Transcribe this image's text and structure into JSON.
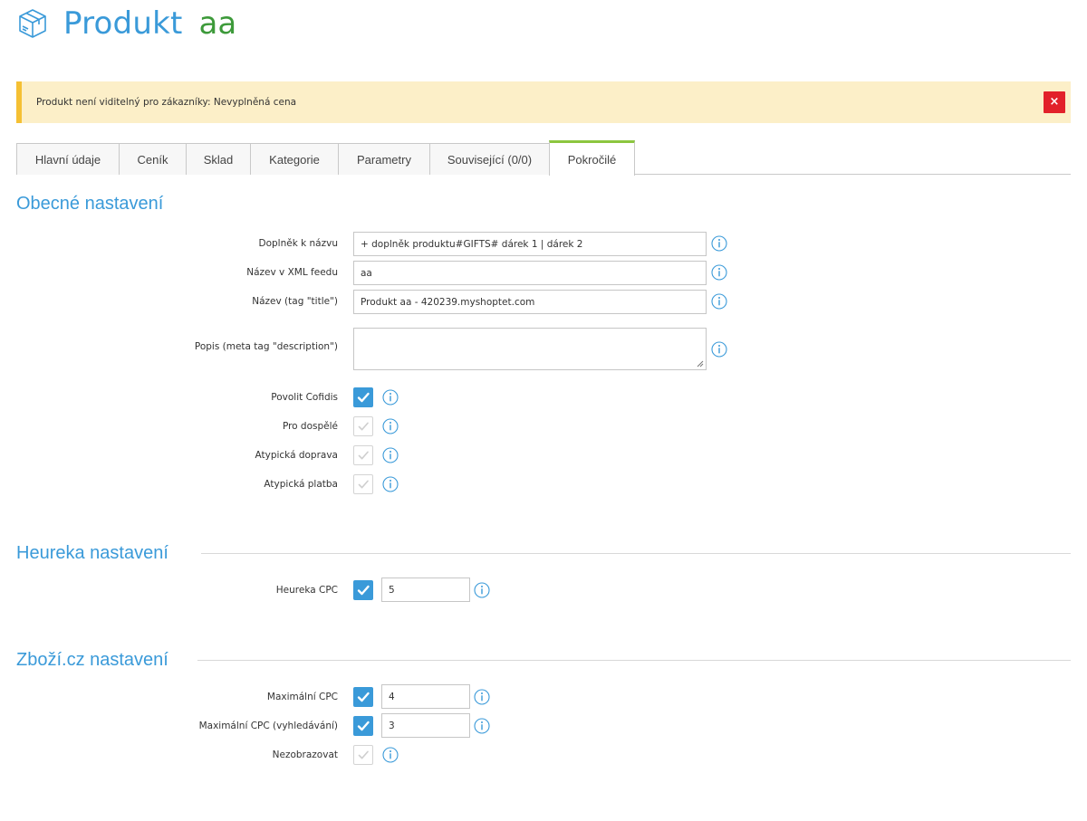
{
  "header": {
    "title": "Produkt",
    "product_name": "aa",
    "icon": "box-icon"
  },
  "alert": {
    "text": "Produkt není viditelný pro zákazníky: Nevyplněná cena",
    "close_label": "×"
  },
  "tabs": [
    {
      "label": "Hlavní údaje",
      "active": false
    },
    {
      "label": "Ceník",
      "active": false
    },
    {
      "label": "Sklad",
      "active": false
    },
    {
      "label": "Kategorie",
      "active": false
    },
    {
      "label": "Parametry",
      "active": false
    },
    {
      "label": "Související (0/0)",
      "active": false
    },
    {
      "label": "Pokročilé",
      "active": true
    }
  ],
  "general": {
    "title": "Obecné nastavení",
    "name_addon": {
      "label": "Doplněk k názvu",
      "value": "+ doplněk produktu#GIFTS# dárek 1 | dárek 2"
    },
    "xml_name": {
      "label": "Název v XML feedu",
      "value": "aa"
    },
    "title_tag": {
      "label": "Název (tag \"title\")",
      "value": "Produkt  aa  - 420239.myshoptet.com"
    },
    "description": {
      "label": "Popis (meta tag \"description\")",
      "value": ""
    },
    "cofidis": {
      "label": "Povolit Cofidis",
      "checked": true
    },
    "adults": {
      "label": "Pro dospělé",
      "checked": false
    },
    "atypical_delivery": {
      "label": "Atypická doprava",
      "checked": false
    },
    "atypical_payment": {
      "label": "Atypická platba",
      "checked": false
    }
  },
  "heureka": {
    "title": "Heureka nastavení",
    "cpc": {
      "label": "Heureka CPC",
      "checked": true,
      "value": "5"
    }
  },
  "zbozi": {
    "title": "Zboží.cz nastavení",
    "max_cpc": {
      "label": "Maximální CPC",
      "checked": true,
      "value": "4"
    },
    "max_cpc_search": {
      "label": "Maximální CPC (vyhledávání)",
      "checked": true,
      "value": "3"
    },
    "hide": {
      "label": "Nezobrazovat",
      "checked": false
    }
  },
  "colors": {
    "accent": "#3a9ad9",
    "green": "#3d9a3a",
    "alert_bg": "#fcefc8",
    "alert_border": "#f5c033",
    "close_bg": "#e2212a",
    "tab_active": "#8cc63f"
  }
}
